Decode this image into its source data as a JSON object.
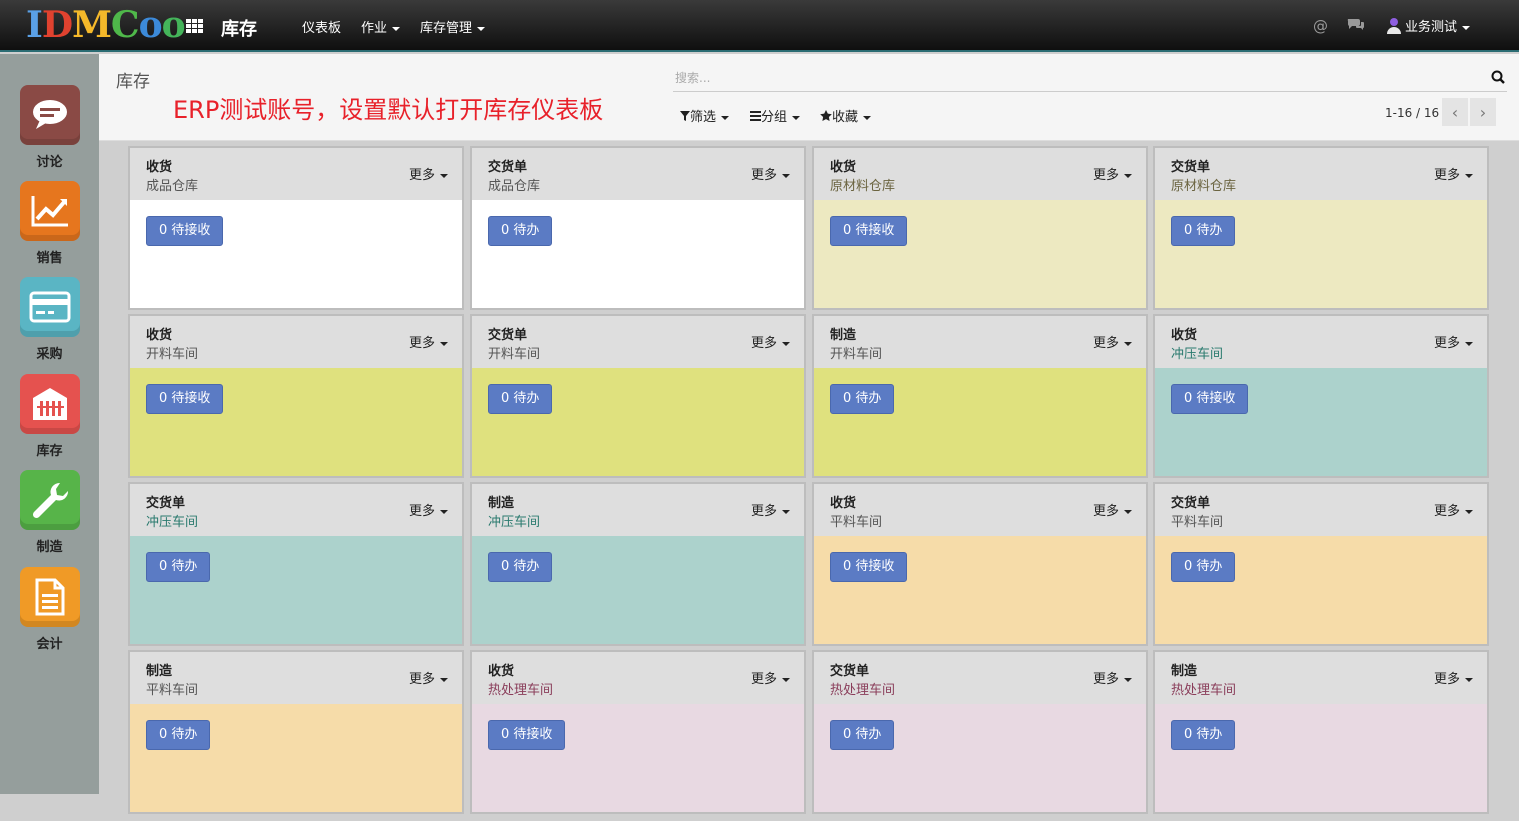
{
  "header": {
    "logo": [
      "I",
      "D",
      "M",
      "C",
      "o",
      "o"
    ],
    "app_title": "库存",
    "menu": [
      {
        "label": "仪表板"
      },
      {
        "label": "作业"
      },
      {
        "label": "库存管理"
      }
    ],
    "user": "业务测试"
  },
  "sidebar": {
    "apps": [
      {
        "label": "讨论",
        "icon": "chat-icon",
        "color": "#8a4a45"
      },
      {
        "label": "销售",
        "icon": "chart-icon",
        "color": "#e6761e"
      },
      {
        "label": "采购",
        "icon": "card-icon",
        "color": "#5ab5c4"
      },
      {
        "label": "库存",
        "icon": "warehouse-icon",
        "color": "#e5524f"
      },
      {
        "label": "制造",
        "icon": "wrench-icon",
        "color": "#57b449"
      },
      {
        "label": "会计",
        "icon": "document-icon",
        "color": "#f09a26"
      }
    ]
  },
  "control": {
    "breadcrumb": "库存",
    "banner": "ERP测试账号，设置默认打开库存仪表板",
    "search_placeholder": "搜索...",
    "filter_label": "筛选",
    "group_label": "分组",
    "favorites_label": "收藏",
    "pager": "1-16 / 16"
  },
  "kanban": {
    "more_label": "更多",
    "colors": {
      "white": "#ffffff",
      "beige": "#ede9c1",
      "lime": "#dfe17e",
      "teal": "#acd2cc",
      "peach": "#f6dca9",
      "lavender": "#e8d9e2"
    },
    "cards": [
      {
        "title": "收货",
        "subtitle": "成品仓库",
        "sub_color": "#555555",
        "button": "0 待接收",
        "color": "#ffffff"
      },
      {
        "title": "交货单",
        "subtitle": "成品仓库",
        "sub_color": "#555555",
        "button": "0 待办",
        "color": "#ffffff"
      },
      {
        "title": "收货",
        "subtitle": "原材料仓库",
        "sub_color": "#6b6440",
        "button": "0 待接收",
        "color": "#ede9c1"
      },
      {
        "title": "交货单",
        "subtitle": "原材料仓库",
        "sub_color": "#6b6440",
        "button": "0 待办",
        "color": "#ede9c1"
      },
      {
        "title": "收货",
        "subtitle": "开料车间",
        "sub_color": "#555555",
        "button": "0 待接收",
        "color": "#dfe17e"
      },
      {
        "title": "交货单",
        "subtitle": "开料车间",
        "sub_color": "#555555",
        "button": "0 待办",
        "color": "#dfe17e"
      },
      {
        "title": "制造",
        "subtitle": "开料车间",
        "sub_color": "#555555",
        "button": "0 待办",
        "color": "#dfe17e"
      },
      {
        "title": "收货",
        "subtitle": "冲压车间",
        "sub_color": "#2a7a6e",
        "button": "0 待接收",
        "color": "#acd2cc"
      },
      {
        "title": "交货单",
        "subtitle": "冲压车间",
        "sub_color": "#2a7a6e",
        "button": "0 待办",
        "color": "#acd2cc"
      },
      {
        "title": "制造",
        "subtitle": "冲压车间",
        "sub_color": "#2a7a6e",
        "button": "0 待办",
        "color": "#acd2cc"
      },
      {
        "title": "收货",
        "subtitle": "平料车间",
        "sub_color": "#555555",
        "button": "0 待接收",
        "color": "#f6dca9"
      },
      {
        "title": "交货单",
        "subtitle": "平料车间",
        "sub_color": "#555555",
        "button": "0 待办",
        "color": "#f6dca9"
      },
      {
        "title": "制造",
        "subtitle": "平料车间",
        "sub_color": "#555555",
        "button": "0 待办",
        "color": "#f6dca9"
      },
      {
        "title": "收货",
        "subtitle": "热处理车间",
        "sub_color": "#8a3d5a",
        "button": "0 待接收",
        "color": "#e8d9e2"
      },
      {
        "title": "交货单",
        "subtitle": "热处理车间",
        "sub_color": "#8a3d5a",
        "button": "0 待办",
        "color": "#e8d9e2"
      },
      {
        "title": "制造",
        "subtitle": "热处理车间",
        "sub_color": "#8a3d5a",
        "button": "0 待办",
        "color": "#e8d9e2"
      }
    ]
  }
}
